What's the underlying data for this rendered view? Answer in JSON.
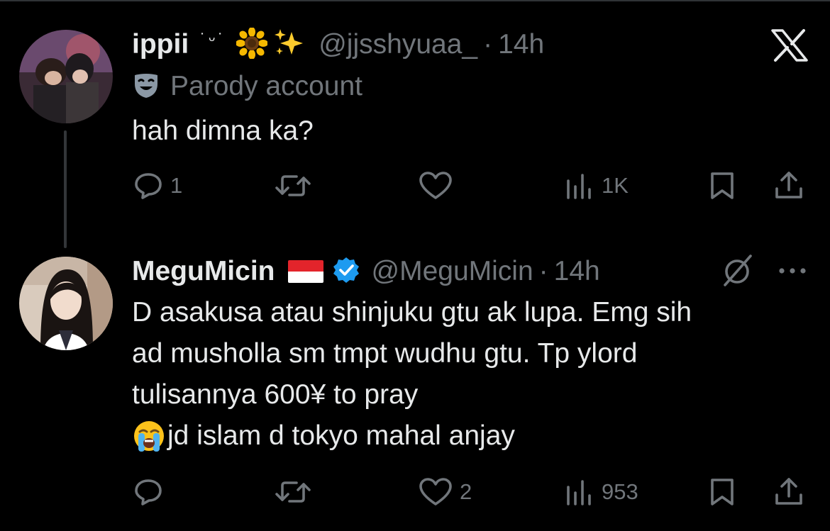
{
  "tweet1": {
    "display_name": "ippii",
    "kaomoji": "˙ᵕ˙",
    "decorations": [
      "sunflower-emoji",
      "sparkles-emoji"
    ],
    "handle": "@jjsshyuaa_",
    "dot": "·",
    "time": "14h",
    "parody_label": "Parody account",
    "text": "hah dimna ka?",
    "actions": {
      "reply_count": "1",
      "retweet_count": "",
      "like_count": "",
      "view_count": "1K"
    }
  },
  "tweet2": {
    "display_name": "MeguMicin",
    "handle": "@MeguMicin",
    "dot": "·",
    "time": "14h",
    "text_lines": [
      "D asakusa atau shinjuku gtu ak lupa. Emg sih",
      "ad musholla sm tmpt wudhu gtu. Tp ylord",
      "tulisannya 600¥ to pray",
      "jd islam d tokyo mahal anjay"
    ],
    "actions": {
      "reply_count": "",
      "retweet_count": "",
      "like_count": "2",
      "view_count": "953"
    }
  },
  "colors": {
    "background": "#000000",
    "primary_text": "#e7e9ea",
    "secondary_text": "#71767b",
    "verified": "#1d9bf0",
    "thread_line": "#333639"
  }
}
